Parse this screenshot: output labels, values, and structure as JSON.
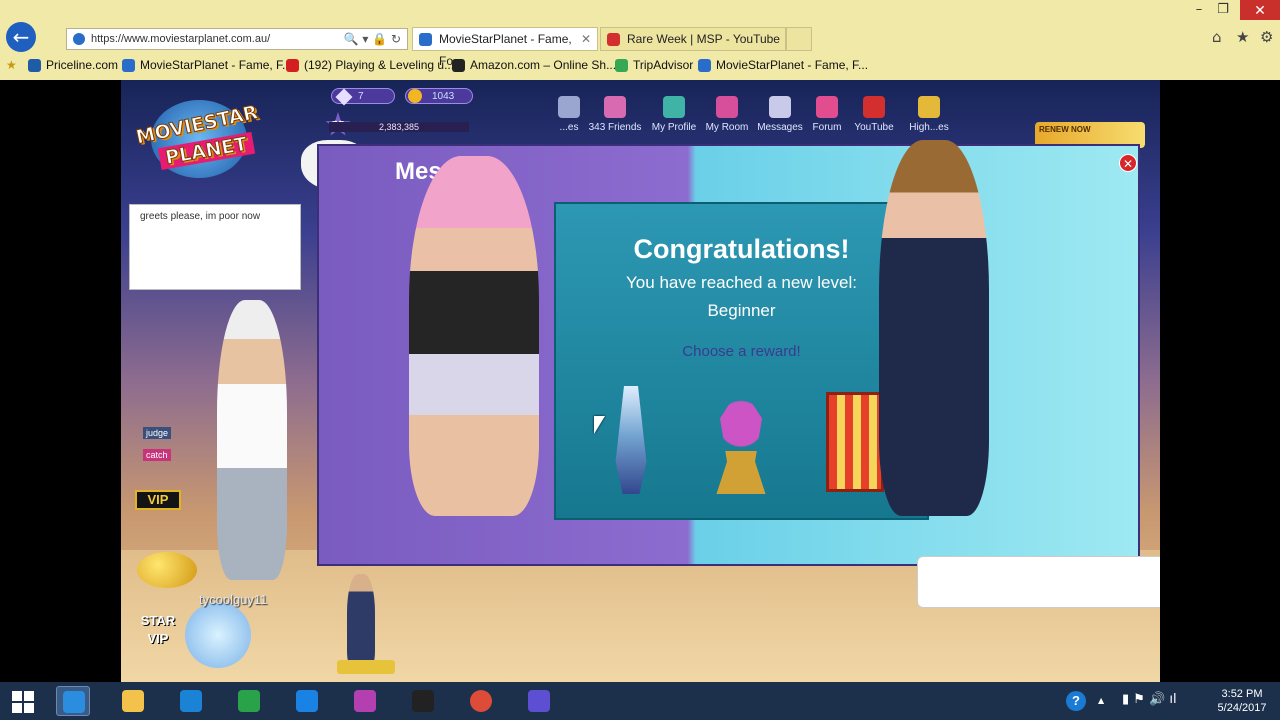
{
  "browser": {
    "address": "https://www.moviestarplanet.com.au/",
    "address_tools": "🔍 ▾ 🔒 ↻",
    "tabs": [
      {
        "label": "MovieStarPlanet - Fame, Fo...",
        "close": "✕"
      },
      {
        "label": "Rare Week | MSP - YouTube",
        "close": ""
      }
    ],
    "window_controls": {
      "minimize": "–",
      "restore": "❐",
      "close": "✕"
    },
    "tools": {
      "home": "⌂",
      "favorites": "★",
      "settings": "⚙"
    },
    "favorites": [
      {
        "label": "Priceline.com",
        "color": "#1f5ca8"
      },
      {
        "label": "MovieStarPlanet - Fame, F...",
        "color": "#2a6cc9"
      },
      {
        "label": "(192) Playing & Leveling u...",
        "color": "#d31f1f"
      },
      {
        "label": "Amazon.com – Online Sh...",
        "color": "#222222"
      },
      {
        "label": "TripAdvisor",
        "color": "#34a853"
      },
      {
        "label": "MovieStarPlanet - Fame, F...",
        "color": "#2a6cc9"
      }
    ]
  },
  "game": {
    "logo_line1": "MOVIESTAR",
    "logo_line2": "PLANET",
    "diamonds": "7",
    "starcoins": "1043",
    "level": "22",
    "fame": "2,383,385",
    "love_counter": "<3",
    "nav": [
      {
        "label": "...es",
        "color": "#9aa5d0"
      },
      {
        "label": "343 Friends",
        "color": "#d86ab2"
      },
      {
        "label": "My Profile",
        "color": "#3fb4a6"
      },
      {
        "label": "My Room",
        "color": "#d74f9a"
      },
      {
        "label": "Messages",
        "color": "#c9c9e9"
      },
      {
        "label": "Forum",
        "color": "#e14d8f"
      },
      {
        "label": "YouTube",
        "color": "#d32f2f"
      },
      {
        "label": "High...es",
        "color": "#e4b93a"
      }
    ],
    "chat_text": "greets please, im poor now",
    "badge_judge": "judge",
    "badge_catch": "catch",
    "vip_label": "VIP",
    "star_vip_line1": "STAR",
    "star_vip_line2": "VIP",
    "username": "tycoolguy11",
    "renew_label": "RENEW NOW",
    "popup_title": "Mess...",
    "popup_close": "✕",
    "congrats": {
      "title": "Congratulations!",
      "line": "You have reached a new level:",
      "level_name": "Beginner",
      "choose": "Choose a reward!"
    }
  },
  "taskbar": {
    "apps": [
      {
        "name": "internet-explorer",
        "color": "#2b8de0"
      },
      {
        "name": "file-explorer",
        "color": "#f2c24a"
      },
      {
        "name": "onedrive",
        "color": "#1b83d6"
      },
      {
        "name": "store",
        "color": "#2aa24a"
      },
      {
        "name": "dropbox",
        "color": "#1a81e5"
      },
      {
        "name": "photo-app",
        "color": "#b33fb0"
      },
      {
        "name": "amazon",
        "color": "#222222"
      },
      {
        "name": "chrome",
        "color": "#dd4b39"
      },
      {
        "name": "settings-app",
        "color": "#5d4fd1"
      }
    ],
    "time": "3:52 PM",
    "date": "5/24/2017",
    "help": "?",
    "tray_up": "▲",
    "tray_icons": "▮ ⚑ 🔊 ıl"
  }
}
